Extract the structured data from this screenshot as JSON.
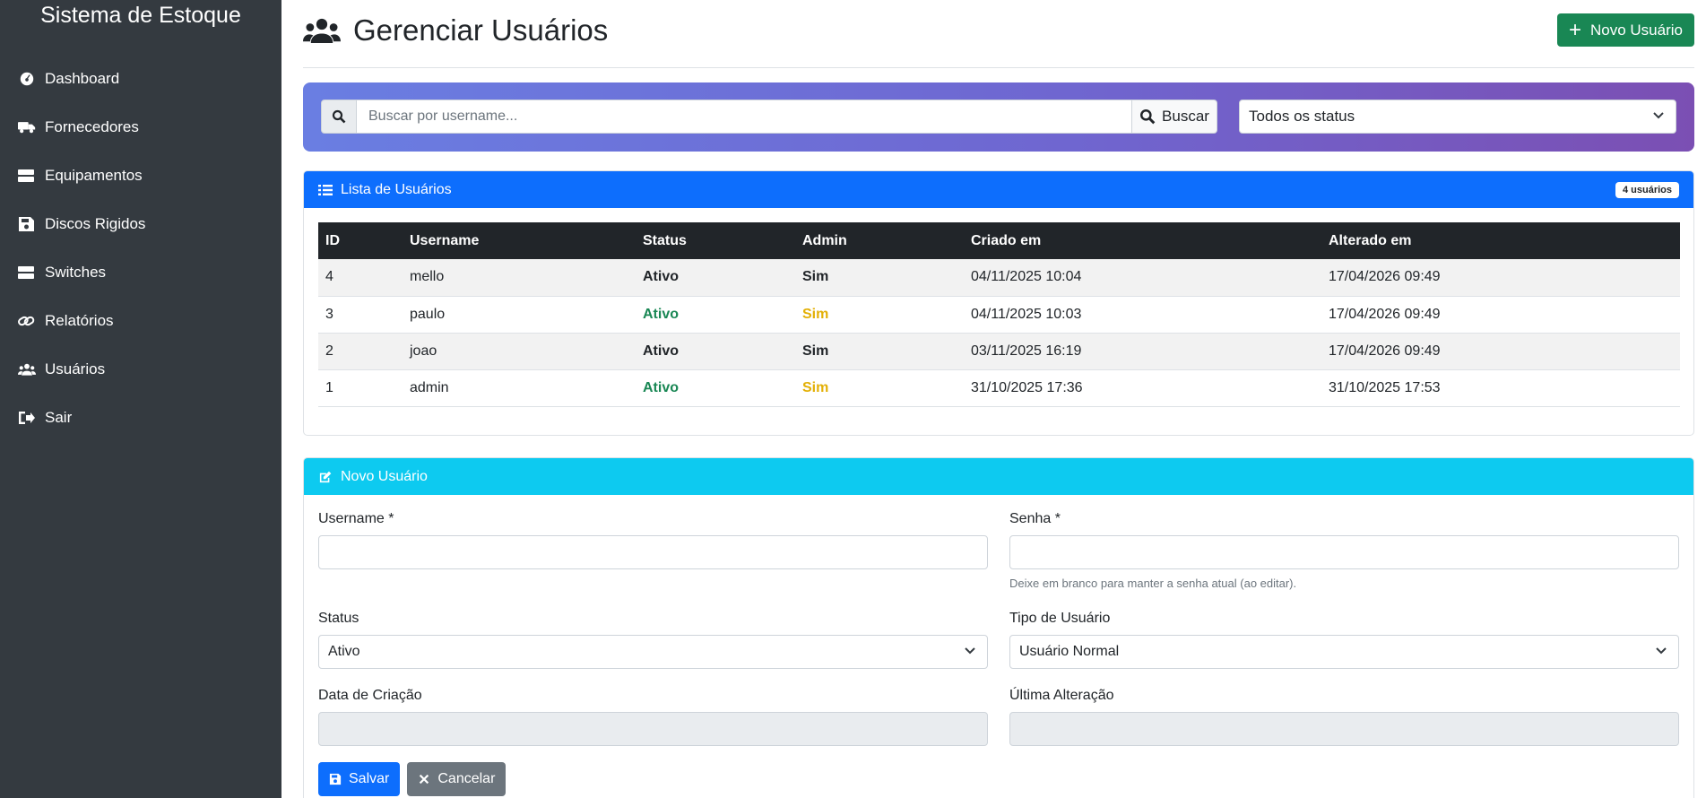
{
  "sidebar": {
    "brand": "Sistema de Estoque",
    "items": [
      {
        "label": "Dashboard",
        "icon": "dashboard-icon"
      },
      {
        "label": "Fornecedores",
        "icon": "truck-icon"
      },
      {
        "label": "Equipamentos",
        "icon": "server-icon"
      },
      {
        "label": "Discos Rigidos",
        "icon": "floppy-icon"
      },
      {
        "label": "Switches",
        "icon": "server-icon"
      },
      {
        "label": "Relatórios",
        "icon": "link-icon"
      },
      {
        "label": "Usuários",
        "icon": "users-icon"
      },
      {
        "label": "Sair",
        "icon": "sign-out-icon"
      }
    ]
  },
  "header": {
    "title": "Gerenciar Usuários",
    "new_button": "Novo Usuário"
  },
  "search": {
    "placeholder": "Buscar por username...",
    "button": "Buscar",
    "status_filter": "Todos os status"
  },
  "list": {
    "title": "Lista de Usuários",
    "badge": "4 usuários",
    "columns": [
      "ID",
      "Username",
      "Status",
      "Admin",
      "Criado em",
      "Alterado em"
    ],
    "rows": [
      {
        "id": "4",
        "username": "mello",
        "status": "Ativo",
        "admin": "Sim",
        "created": "04/11/2025 10:04",
        "updated": "17/04/2026 09:49"
      },
      {
        "id": "3",
        "username": "paulo",
        "status": "Ativo",
        "admin": "Sim",
        "created": "04/11/2025 10:03",
        "updated": "17/04/2026 09:49"
      },
      {
        "id": "2",
        "username": "joao",
        "status": "Ativo",
        "admin": "Sim",
        "created": "03/11/2025 16:19",
        "updated": "17/04/2026 09:49"
      },
      {
        "id": "1",
        "username": "admin",
        "status": "Ativo",
        "admin": "Sim",
        "created": "31/10/2025 17:36",
        "updated": "31/10/2025 17:53"
      }
    ]
  },
  "form": {
    "title": "Novo Usuário",
    "username_label": "Username *",
    "username_value": "",
    "password_label": "Senha *",
    "password_value": "",
    "password_help": "Deixe em branco para manter a senha atual (ao editar).",
    "status_label": "Status",
    "status_value": "Ativo",
    "type_label": "Tipo de Usuário",
    "type_value": "Usuário Normal",
    "created_label": "Data de Criação",
    "created_value": "",
    "updated_label": "Última Alteração",
    "updated_value": "",
    "save_button": "Salvar",
    "cancel_button": "Cancelar"
  },
  "colors": {
    "sidebar_bg": "#343a40",
    "primary": "#0d6efd",
    "success": "#198754",
    "info": "#0dcaf0",
    "warning_text": "#e3b006",
    "secondary": "#6c757d"
  }
}
